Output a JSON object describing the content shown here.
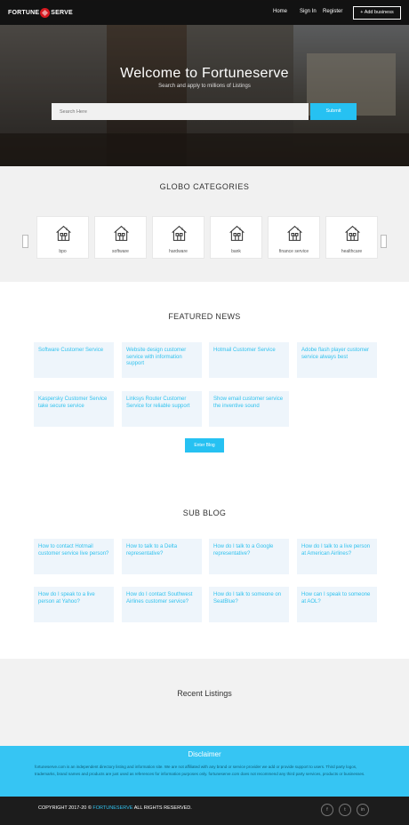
{
  "nav": {
    "logo_left": "FORTUNE",
    "logo_right": "SERVE",
    "home": "Home",
    "signin": "Sign In",
    "register": "Register",
    "add_business": "+ Add business"
  },
  "hero": {
    "title": "Welcome to Fortuneserve",
    "subtitle": "Search and apply to millions of Listings",
    "search_placeholder": "Search Here",
    "submit": "Submit"
  },
  "categories": {
    "title": "GLOBO CATEGORIES",
    "items": [
      "bpo",
      "software",
      "hardware",
      "bank",
      "finance service",
      "healthcare"
    ]
  },
  "featured_news": {
    "title": "FEATURED NEWS",
    "items": [
      "Software Customer Service",
      "Website design customer service with information support",
      "Hotmail Customer Service",
      "Adobe flash player customer service always best",
      "Kaspersky Customer Service take secure service",
      "Linksys Router Customer Service for reliable support",
      "Show email customer service the inventive sound"
    ],
    "more_button": "Enter Blog"
  },
  "sub_blog": {
    "title": "SUB BLOG",
    "items": [
      "How to contact Hotmail customer service live person?",
      "How to talk to a Delta representative?",
      "How do I talk to a Google representative?",
      "How do I talk to a live person at American Airlines?",
      "How do I speak to a live person at Yahoo?",
      "How do I contact Southwest Airlines customer service?",
      "How do I talk to someone on SeatBlue?",
      "How can I speak to someone at AOL?"
    ]
  },
  "recent": {
    "title": "Recent Listings"
  },
  "disclaimer": {
    "title": "Disclaimer",
    "text": "fortuneserve.com is an independent directory listing and information site. We are not affiliated with any brand or service provider we add or provide support to users. Third party logos, trademarks, brand names and products are just used as references for information purposes only. fortuneserve.com does not recommend any third party services, products or businesses."
  },
  "footer": {
    "copyright_prefix": "COPYRIGHT 2017-20 ©",
    "brand": "FORTUNESERVE",
    "copyright_suffix": "ALL RIGHTS RESERVED.",
    "social": [
      "f",
      "t",
      "in"
    ]
  },
  "colors": {
    "accent": "#26c1f2",
    "logo_red": "#d71920",
    "card_bg": "#eef5fb",
    "footer_bg": "#1c1c1c"
  }
}
